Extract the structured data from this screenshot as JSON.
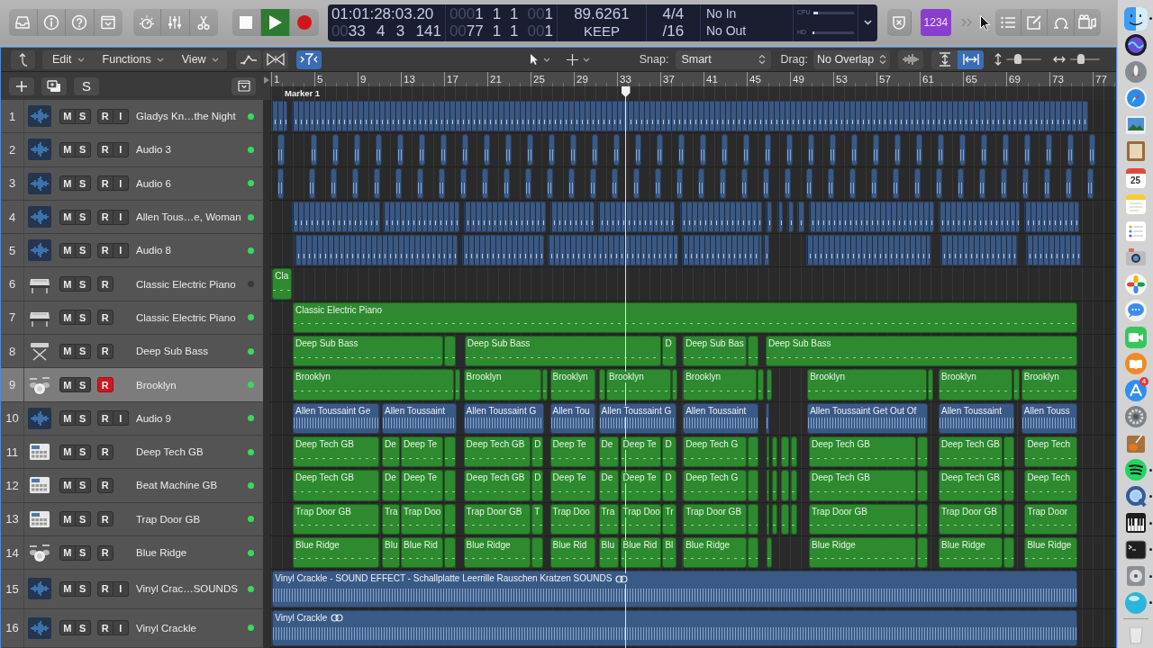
{
  "control_bar": {
    "transport": [
      {
        "kind": "stop",
        "on": false
      },
      {
        "kind": "play",
        "on": true
      },
      {
        "kind": "record",
        "on": false
      }
    ],
    "lcd": {
      "columns": [
        {
          "kind": "position",
          "lines": [
            [
              {
                "text": "01:01:28:03.20"
              }
            ],
            [
              {
                "dim": "00",
                "text": "33"
              },
              {
                "text": "4"
              },
              {
                "text": "3"
              },
              {
                "text": "141"
              }
            ]
          ]
        },
        {
          "kind": "locators",
          "lines": [
            [
              {
                "dim": "000",
                "text": "1"
              },
              {
                "text": "1"
              },
              {
                "text": "1"
              },
              {
                "dim": "00",
                "text": "1"
              }
            ],
            [
              {
                "dim": "00",
                "text": "77"
              },
              {
                "text": "1"
              },
              {
                "text": "1"
              },
              {
                "dim": "00",
                "text": "1"
              }
            ]
          ]
        },
        {
          "kind": "tempo",
          "lines": [
            [
              {
                "text": "89.6261"
              }
            ],
            [
              {
                "text": "KEEP"
              }
            ]
          ]
        },
        {
          "kind": "signature",
          "lines": [
            [
              {
                "text": "4/4"
              }
            ],
            [
              {
                "text": "/16"
              }
            ]
          ]
        },
        {
          "kind": "in-out",
          "lines": [
            [
              {
                "text": "No In"
              }
            ],
            [
              {
                "text": "No Out"
              }
            ]
          ]
        }
      ],
      "meters": [
        {
          "label": "CPU",
          "level": 0.12
        },
        {
          "label": "HD",
          "level": 0
        }
      ]
    },
    "count_in": {
      "label": "1234",
      "on": true
    }
  },
  "arrange_toolbar": {
    "menus": [
      "Edit",
      "Functions",
      "View"
    ],
    "tools": [
      {
        "kind": "automation",
        "on": false
      },
      {
        "kind": "flex",
        "on": false
      },
      {
        "kind": "catch",
        "on": true
      }
    ],
    "snap": {
      "label": "Snap:",
      "value": "Smart"
    },
    "drag": {
      "label": "Drag:",
      "value": "No Overlap"
    },
    "zoom_buttons": [
      {
        "kind": "waveform",
        "on": false
      },
      {
        "kind": "vertical",
        "on": false
      },
      {
        "kind": "horizontal",
        "on": true
      }
    ],
    "sliders": [
      {
        "kind": "vertical",
        "level": 0.33
      },
      {
        "kind": "horizontal",
        "level": 0.36
      }
    ]
  },
  "track_list": {
    "solo_label": "S"
  },
  "ruler": {
    "bars": [
      "1",
      "5",
      "9",
      "13",
      "17",
      "21",
      "25",
      "29",
      "33",
      "37",
      "41",
      "45",
      "49",
      "53",
      "57",
      "61",
      "65",
      "69",
      "73",
      "77"
    ],
    "markers": [
      {
        "label": "Marker 1"
      }
    ]
  },
  "tracks": [
    {
      "number": "1",
      "kind": "audio",
      "name": "Gladys Kn…the Night",
      "selected": false,
      "active": true,
      "buttons": [
        {
          "kind": "mute",
          "label": "M",
          "on": false
        },
        {
          "kind": "solo",
          "label": "S",
          "on": false
        },
        {
          "kind": "record",
          "label": "R",
          "on": false
        },
        {
          "kind": "input",
          "label": "I",
          "on": false
        }
      ],
      "regions": [
        {
          "kind": "audio-slices"
        },
        {
          "kind": "audio-slices"
        }
      ]
    },
    {
      "number": "2",
      "kind": "audio",
      "name": "Audio 3",
      "selected": false,
      "active": true,
      "buttons": [
        {
          "kind": "mute",
          "label": "M",
          "on": false
        },
        {
          "kind": "solo",
          "label": "S",
          "on": false
        },
        {
          "kind": "record",
          "label": "R",
          "on": false
        },
        {
          "kind": "input",
          "label": "I",
          "on": false
        }
      ],
      "regions": [
        {
          "kind": "audio"
        },
        {
          "kind": "audio"
        },
        {
          "kind": "audio"
        },
        {
          "kind": "audio"
        },
        {
          "kind": "audio"
        },
        {
          "kind": "audio"
        },
        {
          "kind": "audio"
        },
        {
          "kind": "audio"
        },
        {
          "kind": "audio"
        },
        {
          "kind": "audio"
        },
        {
          "kind": "audio"
        },
        {
          "kind": "audio"
        },
        {
          "kind": "audio"
        },
        {
          "kind": "audio"
        },
        {
          "kind": "audio"
        },
        {
          "kind": "audio"
        },
        {
          "kind": "audio"
        },
        {
          "kind": "audio"
        },
        {
          "kind": "audio"
        },
        {
          "kind": "audio"
        },
        {
          "kind": "audio"
        },
        {
          "kind": "audio"
        },
        {
          "kind": "audio"
        },
        {
          "kind": "audio"
        },
        {
          "kind": "audio"
        },
        {
          "kind": "audio"
        },
        {
          "kind": "audio"
        },
        {
          "kind": "audio"
        },
        {
          "kind": "audio"
        },
        {
          "kind": "audio"
        },
        {
          "kind": "audio"
        },
        {
          "kind": "audio"
        },
        {
          "kind": "audio"
        },
        {
          "kind": "audio"
        },
        {
          "kind": "audio"
        },
        {
          "kind": "audio"
        },
        {
          "kind": "audio"
        },
        {
          "kind": "audio"
        }
      ]
    },
    {
      "number": "3",
      "kind": "audio",
      "name": "Audio 6",
      "selected": false,
      "active": true,
      "buttons": [
        {
          "kind": "mute",
          "label": "M",
          "on": false
        },
        {
          "kind": "solo",
          "label": "S",
          "on": false
        },
        {
          "kind": "record",
          "label": "R",
          "on": false
        },
        {
          "kind": "input",
          "label": "I",
          "on": false
        }
      ],
      "regions": [
        {
          "kind": "audio"
        },
        {
          "kind": "audio"
        },
        {
          "kind": "audio"
        },
        {
          "kind": "audio"
        },
        {
          "kind": "audio"
        },
        {
          "kind": "audio"
        },
        {
          "kind": "audio"
        },
        {
          "kind": "audio"
        },
        {
          "kind": "audio"
        },
        {
          "kind": "audio"
        },
        {
          "kind": "audio"
        },
        {
          "kind": "audio"
        },
        {
          "kind": "audio"
        },
        {
          "kind": "audio"
        },
        {
          "kind": "audio"
        },
        {
          "kind": "audio"
        },
        {
          "kind": "audio"
        },
        {
          "kind": "audio"
        },
        {
          "kind": "audio"
        },
        {
          "kind": "audio"
        },
        {
          "kind": "audio"
        },
        {
          "kind": "audio"
        },
        {
          "kind": "audio"
        },
        {
          "kind": "audio"
        },
        {
          "kind": "audio"
        },
        {
          "kind": "audio"
        },
        {
          "kind": "audio"
        },
        {
          "kind": "audio"
        },
        {
          "kind": "audio"
        },
        {
          "kind": "audio"
        },
        {
          "kind": "audio"
        },
        {
          "kind": "audio"
        },
        {
          "kind": "audio"
        },
        {
          "kind": "audio"
        },
        {
          "kind": "audio"
        },
        {
          "kind": "audio"
        },
        {
          "kind": "audio"
        },
        {
          "kind": "audio"
        }
      ]
    },
    {
      "number": "4",
      "kind": "audio",
      "name": "Allen Tous…e, Woman",
      "selected": false,
      "active": true,
      "buttons": [
        {
          "kind": "mute",
          "label": "M",
          "on": false
        },
        {
          "kind": "solo",
          "label": "S",
          "on": false
        },
        {
          "kind": "record",
          "label": "R",
          "on": false
        },
        {
          "kind": "input",
          "label": "I",
          "on": false
        }
      ],
      "regions": [
        {
          "kind": "audio-slices"
        },
        {
          "kind": "audio-slices"
        },
        {
          "kind": "audio-slices"
        },
        {
          "kind": "audio-slices"
        },
        {
          "kind": "audio-slices"
        },
        {
          "kind": "audio-slices"
        },
        {
          "kind": "audio-slices"
        },
        {
          "kind": "audio-slices"
        },
        {
          "kind": "audio-slices"
        },
        {
          "kind": "audio-slices"
        },
        {
          "kind": "audio-slices"
        },
        {
          "kind": "audio-slices"
        },
        {
          "kind": "audio-slices"
        }
      ]
    },
    {
      "number": "5",
      "kind": "audio",
      "name": "Audio 8",
      "selected": false,
      "active": true,
      "buttons": [
        {
          "kind": "mute",
          "label": "M",
          "on": false
        },
        {
          "kind": "solo",
          "label": "S",
          "on": false
        },
        {
          "kind": "record",
          "label": "R",
          "on": false
        },
        {
          "kind": "input",
          "label": "I",
          "on": false
        }
      ],
      "regions": [
        {
          "kind": "audio-slices"
        },
        {
          "kind": "audio-slices"
        },
        {
          "kind": "audio-slices"
        },
        {
          "kind": "audio-slices"
        },
        {
          "kind": "audio-slices"
        },
        {
          "kind": "audio-slices"
        },
        {
          "kind": "audio-slices"
        },
        {
          "kind": "audio-slices"
        }
      ]
    },
    {
      "number": "6",
      "kind": "electric-piano",
      "name": "Classic Electric Piano",
      "selected": false,
      "active": false,
      "buttons": [
        {
          "kind": "mute",
          "label": "M",
          "on": false
        },
        {
          "kind": "solo",
          "label": "S",
          "on": false
        },
        {
          "kind": "record",
          "label": "R",
          "on": false
        }
      ],
      "regions": [
        {
          "kind": "midi",
          "name": "Cla"
        }
      ]
    },
    {
      "number": "7",
      "kind": "electric-piano",
      "name": "Classic Electric Piano",
      "selected": false,
      "active": true,
      "buttons": [
        {
          "kind": "mute",
          "label": "M",
          "on": false
        },
        {
          "kind": "solo",
          "label": "S",
          "on": false
        },
        {
          "kind": "record",
          "label": "R",
          "on": false
        }
      ],
      "regions": [
        {
          "kind": "midi",
          "name": "Classic Electric Piano"
        }
      ]
    },
    {
      "number": "8",
      "kind": "synth-keyboard",
      "name": "Deep Sub Bass",
      "selected": false,
      "active": true,
      "buttons": [
        {
          "kind": "mute",
          "label": "M",
          "on": false
        },
        {
          "kind": "solo",
          "label": "S",
          "on": false
        },
        {
          "kind": "record",
          "label": "R",
          "on": false
        }
      ],
      "regions": [
        {
          "kind": "midi",
          "name": "Deep Sub Bass"
        },
        {
          "kind": "midi"
        },
        {
          "kind": "midi",
          "name": "Deep Sub Bass"
        },
        {
          "kind": "midi",
          "name": "D"
        },
        {
          "kind": "midi",
          "name": "Deep Sub Bas"
        },
        {
          "kind": "midi"
        },
        {
          "kind": "midi",
          "name": "Deep Sub Bass"
        }
      ]
    },
    {
      "number": "9",
      "kind": "drum-kit",
      "name": "Brooklyn",
      "selected": true,
      "active": true,
      "buttons": [
        {
          "kind": "mute",
          "label": "M",
          "on": false
        },
        {
          "kind": "solo",
          "label": "S",
          "on": false
        },
        {
          "kind": "record",
          "label": "R",
          "on": true
        }
      ],
      "regions": [
        {
          "kind": "midi",
          "name": "Brooklyn"
        },
        {
          "kind": "midi"
        },
        {
          "kind": "midi",
          "name": "Brooklyn"
        },
        {
          "kind": "midi"
        },
        {
          "kind": "midi",
          "name": "Brooklyn"
        },
        {
          "kind": "midi"
        },
        {
          "kind": "midi",
          "name": "Brooklyn"
        },
        {
          "kind": "midi"
        },
        {
          "kind": "midi",
          "name": "Brooklyn"
        },
        {
          "kind": "midi"
        },
        {
          "kind": "midi"
        },
        {
          "kind": "midi",
          "name": "Brooklyn"
        },
        {
          "kind": "midi"
        },
        {
          "kind": "midi",
          "name": "Brooklyn"
        },
        {
          "kind": "midi"
        },
        {
          "kind": "midi",
          "name": "Brooklyn"
        }
      ]
    },
    {
      "number": "10",
      "kind": "audio",
      "name": "Audio 9",
      "selected": false,
      "active": true,
      "buttons": [
        {
          "kind": "mute",
          "label": "M",
          "on": false
        },
        {
          "kind": "solo",
          "label": "S",
          "on": false
        },
        {
          "kind": "record",
          "label": "R",
          "on": false
        },
        {
          "kind": "input",
          "label": "I",
          "on": false
        }
      ],
      "regions": [
        {
          "kind": "audio",
          "name": "Allen Toussaint Ge"
        },
        {
          "kind": "audio",
          "name": "Allen Toussaint"
        },
        {
          "kind": "audio",
          "name": "Allen Toussaint G"
        },
        {
          "kind": "audio",
          "name": "Allen Tou"
        },
        {
          "kind": "audio",
          "name": "Allen Toussaint G"
        },
        {
          "kind": "audio",
          "name": "Allen Toussaint"
        },
        {
          "kind": "audio"
        },
        {
          "kind": "audio",
          "name": "Allen Toussaint Get Out Of"
        },
        {
          "kind": "audio",
          "name": "Allen Toussaint"
        },
        {
          "kind": "audio",
          "name": "Allen Touss"
        }
      ]
    },
    {
      "number": "11",
      "kind": "drum-machine",
      "name": "Deep Tech GB",
      "selected": false,
      "active": true,
      "buttons": [
        {
          "kind": "mute",
          "label": "M",
          "on": false
        },
        {
          "kind": "solo",
          "label": "S",
          "on": false
        },
        {
          "kind": "record",
          "label": "R",
          "on": false
        }
      ],
      "regions": [
        {
          "kind": "midi",
          "name": "Deep Tech GB"
        },
        {
          "kind": "midi",
          "name": "De"
        },
        {
          "kind": "midi",
          "name": "Deep Te"
        },
        {
          "kind": "midi"
        },
        {
          "kind": "midi",
          "name": "Deep Tech GB"
        },
        {
          "kind": "midi",
          "name": "D"
        },
        {
          "kind": "midi",
          "name": "Deep Te"
        },
        {
          "kind": "midi",
          "name": "De"
        },
        {
          "kind": "midi",
          "name": "Deep Te"
        },
        {
          "kind": "midi",
          "name": "D"
        },
        {
          "kind": "midi",
          "name": "Deep Tech G"
        },
        {
          "kind": "midi"
        },
        {
          "kind": "midi"
        },
        {
          "kind": "midi"
        },
        {
          "kind": "midi"
        },
        {
          "kind": "midi"
        },
        {
          "kind": "midi",
          "name": "Deep Tech GB"
        },
        {
          "kind": "midi"
        },
        {
          "kind": "midi",
          "name": "Deep Tech GB"
        },
        {
          "kind": "midi"
        },
        {
          "kind": "midi",
          "name": "Deep Tech"
        }
      ]
    },
    {
      "number": "12",
      "kind": "drum-machine",
      "name": "Beat Machine GB",
      "selected": false,
      "active": true,
      "buttons": [
        {
          "kind": "mute",
          "label": "M",
          "on": false
        },
        {
          "kind": "solo",
          "label": "S",
          "on": false
        },
        {
          "kind": "record",
          "label": "R",
          "on": false
        }
      ],
      "regions": [
        {
          "kind": "midi",
          "name": "Deep Tech GB"
        },
        {
          "kind": "midi",
          "name": "De"
        },
        {
          "kind": "midi",
          "name": "Deep Te"
        },
        {
          "kind": "midi"
        },
        {
          "kind": "midi",
          "name": "Deep Tech GB"
        },
        {
          "kind": "midi",
          "name": "D"
        },
        {
          "kind": "midi",
          "name": "Deep Te"
        },
        {
          "kind": "midi",
          "name": "De"
        },
        {
          "kind": "midi",
          "name": "Deep Te"
        },
        {
          "kind": "midi",
          "name": "D"
        },
        {
          "kind": "midi",
          "name": "Deep Tech G"
        },
        {
          "kind": "midi"
        },
        {
          "kind": "midi"
        },
        {
          "kind": "midi"
        },
        {
          "kind": "midi"
        },
        {
          "kind": "midi"
        },
        {
          "kind": "midi",
          "name": "Deep Tech GB"
        },
        {
          "kind": "midi"
        },
        {
          "kind": "midi",
          "name": "Deep Tech GB"
        },
        {
          "kind": "midi"
        },
        {
          "kind": "midi",
          "name": "Deep Tech"
        }
      ]
    },
    {
      "number": "13",
      "kind": "drum-machine",
      "name": "Trap Door GB",
      "selected": false,
      "active": true,
      "buttons": [
        {
          "kind": "mute",
          "label": "M",
          "on": false
        },
        {
          "kind": "solo",
          "label": "S",
          "on": false
        },
        {
          "kind": "record",
          "label": "R",
          "on": false
        }
      ],
      "regions": [
        {
          "kind": "midi",
          "name": "Trap Door GB"
        },
        {
          "kind": "midi",
          "name": "Tra"
        },
        {
          "kind": "midi",
          "name": "Trap Doo"
        },
        {
          "kind": "midi"
        },
        {
          "kind": "midi",
          "name": "Trap Door GB"
        },
        {
          "kind": "midi",
          "name": "T"
        },
        {
          "kind": "midi",
          "name": "Trap Doo"
        },
        {
          "kind": "midi",
          "name": "Tra"
        },
        {
          "kind": "midi",
          "name": "Trap Doo"
        },
        {
          "kind": "midi",
          "name": "Tr"
        },
        {
          "kind": "midi",
          "name": "Trap Door GB"
        },
        {
          "kind": "midi"
        },
        {
          "kind": "midi"
        },
        {
          "kind": "midi"
        },
        {
          "kind": "midi"
        },
        {
          "kind": "midi"
        },
        {
          "kind": "midi",
          "name": "Trap Door GB"
        },
        {
          "kind": "midi"
        },
        {
          "kind": "midi",
          "name": "Trap Door GB"
        },
        {
          "kind": "midi"
        },
        {
          "kind": "midi",
          "name": "Trap Door"
        }
      ]
    },
    {
      "number": "14",
      "kind": "drum-kit",
      "name": "Blue Ridge",
      "selected": false,
      "active": true,
      "buttons": [
        {
          "kind": "mute",
          "label": "M",
          "on": false
        },
        {
          "kind": "solo",
          "label": "S",
          "on": false
        },
        {
          "kind": "record",
          "label": "R",
          "on": false
        }
      ],
      "regions": [
        {
          "kind": "midi",
          "name": "Blue Ridge"
        },
        {
          "kind": "midi",
          "name": "Blu"
        },
        {
          "kind": "midi",
          "name": "Blue Rid"
        },
        {
          "kind": "midi"
        },
        {
          "kind": "midi",
          "name": "Blue Ridge"
        },
        {
          "kind": "midi"
        },
        {
          "kind": "midi",
          "name": "Blue Rid"
        },
        {
          "kind": "midi",
          "name": "Blu"
        },
        {
          "kind": "midi",
          "name": "Blue Rid"
        },
        {
          "kind": "midi",
          "name": "Bl"
        },
        {
          "kind": "midi",
          "name": "Blue Ridge"
        },
        {
          "kind": "midi"
        },
        {
          "kind": "midi"
        },
        {
          "kind": "midi",
          "name": "Blue Ridge"
        },
        {
          "kind": "midi"
        },
        {
          "kind": "midi",
          "name": "Blue Ridge"
        },
        {
          "kind": "midi"
        },
        {
          "kind": "midi",
          "name": "Blue Ridge"
        }
      ]
    },
    {
      "number": "15",
      "kind": "audio",
      "name": "Vinyl Crac…SOUNDS",
      "selected": false,
      "active": true,
      "buttons": [
        {
          "kind": "mute",
          "label": "M",
          "on": false
        },
        {
          "kind": "solo",
          "label": "S",
          "on": false
        },
        {
          "kind": "record",
          "label": "R",
          "on": false
        },
        {
          "kind": "input",
          "label": "I",
          "on": false
        }
      ],
      "regions": [
        {
          "kind": "audio",
          "name": "Vinyl Crackle - SOUND EFFECT - Schallplatte Leerrille Rauschen Kratzen SOUNDS",
          "follow_tempo": true
        }
      ]
    },
    {
      "number": "16",
      "kind": "audio",
      "name": "Vinyl Crackle",
      "selected": false,
      "active": true,
      "buttons": [
        {
          "kind": "mute",
          "label": "M",
          "on": false
        },
        {
          "kind": "solo",
          "label": "S",
          "on": false
        },
        {
          "kind": "record",
          "label": "R",
          "on": false
        },
        {
          "kind": "input",
          "label": "I",
          "on": false
        }
      ],
      "regions": [
        {
          "kind": "audio",
          "name": "Vinyl Crackle",
          "follow_tempo": true
        }
      ]
    }
  ],
  "dock": {
    "items": [
      {
        "kind": "face",
        "running": true
      },
      {
        "kind": "orb",
        "running": false
      },
      {
        "kind": "rocket",
        "running": false
      },
      {
        "kind": "compass",
        "running": false
      },
      {
        "kind": "photo",
        "running": false
      },
      {
        "kind": "notebook",
        "running": false
      },
      {
        "kind": "calendar",
        "date": "25",
        "running": false
      },
      {
        "kind": "notepad",
        "running": false
      },
      {
        "kind": "checklist",
        "running": false
      },
      {
        "kind": "camera",
        "running": false
      },
      {
        "kind": "flower",
        "running": false
      },
      {
        "kind": "chat-bubble",
        "running": false
      },
      {
        "kind": "video-call",
        "running": false
      },
      {
        "kind": "open-book",
        "running": false
      },
      {
        "kind": "letter-a",
        "badge": "4",
        "running": false
      },
      {
        "kind": "gear",
        "running": false
      },
      {
        "kind": "guitar",
        "running": false
      },
      {
        "kind": "sound-waves",
        "running": true
      },
      {
        "kind": "q-letter",
        "running": true
      },
      {
        "kind": "piano-keys",
        "running": true
      },
      {
        "kind": "prompt-window",
        "running": true
      },
      {
        "kind": "disk",
        "running": true
      },
      {
        "kind": "sphere",
        "running": true
      },
      {
        "kind": "trash",
        "running": false
      }
    ]
  }
}
